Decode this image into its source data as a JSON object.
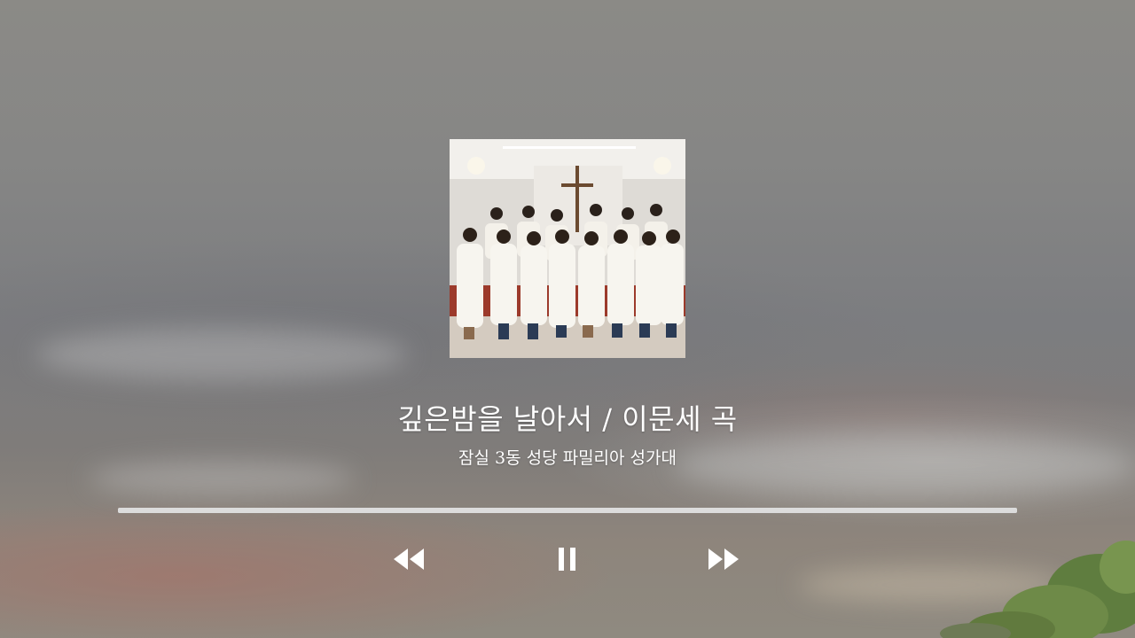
{
  "player": {
    "title": "깊은밤을 날아서 / 이문세 곡",
    "artist": "잠실 3동 성당 파밀리아 성가대",
    "progress_fraction": 1.0
  },
  "controls": {
    "rewind_icon": "rewind-icon",
    "pause_icon": "pause-icon",
    "forward_icon": "fast-forward-icon"
  },
  "colors": {
    "text": "#ffffff",
    "progress_track": "#dcdcdc"
  }
}
